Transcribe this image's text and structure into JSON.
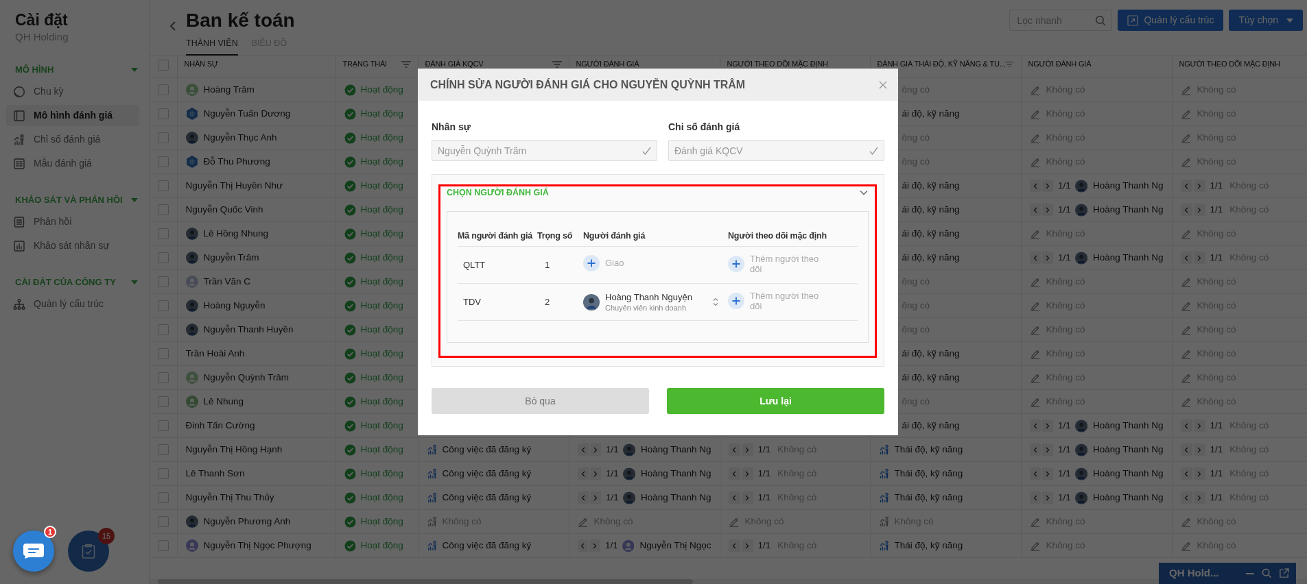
{
  "sidebar": {
    "title": "Cài đặt",
    "subtitle": "QH Holding",
    "sections": [
      {
        "heading": "MÔ HÌNH",
        "expanded": true,
        "items": [
          {
            "label": "Chu kỳ",
            "selected": false
          },
          {
            "label": "Mô hình đánh giá",
            "selected": true
          },
          {
            "label": "Chỉ số đánh giá",
            "selected": false
          },
          {
            "label": "Mẫu đánh giá",
            "selected": false
          }
        ]
      },
      {
        "heading": "KHẢO SÁT VÀ PHẢN HỒI",
        "expanded": true,
        "items": [
          {
            "label": "Phản hồi",
            "selected": false
          },
          {
            "label": "Khảo sát nhân sự",
            "selected": false
          }
        ]
      },
      {
        "heading": "CÀI ĐẶT CỦA CÔNG TY",
        "expanded": true,
        "items": [
          {
            "label": "Quản lý cấu trúc",
            "selected": false
          }
        ]
      }
    ]
  },
  "page": {
    "title": "Ban kế toán",
    "tabs": [
      {
        "label": "THÀNH VIÊN",
        "selected": true
      },
      {
        "label": "BIỂU ĐỒ",
        "selected": false
      }
    ]
  },
  "toolbar": {
    "search": {
      "placeholder": "Lọc nhanh"
    },
    "buttons": [
      {
        "label": "Quản lý cấu trúc",
        "kind": "link"
      },
      {
        "label": "Tùy chọn",
        "kind": "dropdown"
      }
    ]
  },
  "table": {
    "all_checked": false,
    "columns": [
      {
        "label": "NHÂN SỰ",
        "filter": false
      },
      {
        "label": "TRẠNG THÁI",
        "filter": true
      },
      {
        "label": "ĐÁNH GIÁ KQCV",
        "filter": true
      },
      {
        "label": "NGƯỜI ĐÁNH GIÁ",
        "filter": false
      },
      {
        "label": "NGƯỜI THEO DÕI MẶC ĐỊNH",
        "filter": false
      },
      {
        "label": "ĐÁNH GIÁ THÁI ĐỘ, KỸ NĂNG & TU...",
        "filter": true
      },
      {
        "label": "NGƯỜI ĐÁNH GIÁ",
        "filter": false
      },
      {
        "label": "NGƯỜI THEO DÕI MẶC ĐỊNH",
        "filter": false
      }
    ],
    "rows": [
      {
        "checked": false,
        "name": "Hoàng Trâm",
        "avatar": {
          "kind": "person",
          "color": "#394f39"
        },
        "status": "Hoạt động",
        "attitude": {
          "kind": "metric-cut",
          "text": "ông có",
          "empty": true
        },
        "attitude_reviewer": {
          "kind": "edit",
          "text": "Không có"
        },
        "attitude_follower": {
          "kind": "edit",
          "text": "Không có"
        }
      },
      {
        "checked": false,
        "name": "Nguyễn Tuấn Dương",
        "avatar": {
          "kind": "logo"
        },
        "status": "Hoạt động",
        "attitude": {
          "kind": "metric-cut",
          "text": "ái độ, kỹ năng",
          "empty": false
        },
        "attitude_reviewer": {
          "kind": "edit",
          "text": "Không có"
        },
        "attitude_follower": {
          "kind": "edit",
          "text": "Không có"
        }
      },
      {
        "checked": false,
        "name": "Nguyễn Thục Anh",
        "avatar": {
          "kind": "photo"
        },
        "status": "Hoạt động",
        "attitude": {
          "kind": "metric-cut",
          "text": "ông có",
          "empty": true
        },
        "attitude_reviewer": {
          "kind": "edit",
          "text": "Không có"
        },
        "attitude_follower": {
          "kind": "edit",
          "text": "Không có"
        }
      },
      {
        "checked": false,
        "name": "Đỗ Thu Phương",
        "avatar": {
          "kind": "logo"
        },
        "status": "Hoạt động",
        "attitude": {
          "kind": "metric-cut",
          "text": "ông có",
          "empty": true
        },
        "attitude_reviewer": {
          "kind": "edit",
          "text": "Không có"
        },
        "attitude_follower": {
          "kind": "edit",
          "text": "Không có"
        }
      },
      {
        "checked": false,
        "name": "Nguyễn Thị Huyền Như",
        "status": "Hoạt động",
        "attitude": {
          "kind": "metric-cut",
          "text": "ái độ, kỹ năng",
          "empty": false
        },
        "attitude_reviewer": {
          "kind": "pager",
          "page": "1/1",
          "person": "Hoàng Thanh Ng",
          "avatar": {
            "kind": "photo"
          }
        },
        "attitude_follower": {
          "kind": "pager",
          "page": "1/1",
          "text": "Không có"
        }
      },
      {
        "checked": false,
        "name": "Nguyễn Quốc Vinh",
        "status": "Hoạt động",
        "attitude": {
          "kind": "metric-cut",
          "text": "ái độ, kỹ năng",
          "empty": false
        },
        "attitude_reviewer": {
          "kind": "pager",
          "page": "1/1",
          "person": "Hoàng Thanh Ng",
          "avatar": {
            "kind": "photo"
          }
        },
        "attitude_follower": {
          "kind": "pager",
          "page": "1/1",
          "text": "Không có"
        }
      },
      {
        "checked": false,
        "name": "Lê Hồng Nhung",
        "avatar": {
          "kind": "photo"
        },
        "status": "Hoạt động",
        "attitude": {
          "kind": "metric-cut",
          "text": "ái độ, kỹ năng",
          "empty": false
        },
        "attitude_reviewer": {
          "kind": "edit",
          "text": "Không có"
        },
        "attitude_follower": {
          "kind": "edit",
          "text": "Không có"
        }
      },
      {
        "checked": false,
        "name": "Nguyễn Trâm",
        "avatar": {
          "kind": "photo"
        },
        "status": "Hoạt động",
        "attitude": {
          "kind": "metric-cut",
          "text": "ái độ, kỹ năng",
          "empty": false
        },
        "attitude_reviewer": {
          "kind": "pager",
          "page": "1/1",
          "person": "Hoàng Thanh Ng",
          "avatar": {
            "kind": "photo"
          }
        },
        "attitude_follower": {
          "kind": "pager",
          "page": "1/1",
          "text": "Không có"
        }
      },
      {
        "checked": false,
        "name": "Trần Văn C",
        "avatar": {
          "kind": "person",
          "color": "#484c57"
        },
        "status": "Hoạt động",
        "attitude": {
          "kind": "metric-cut",
          "text": "ông có",
          "empty": true
        },
        "attitude_reviewer": {
          "kind": "edit",
          "text": "Không có"
        },
        "attitude_follower": {
          "kind": "edit",
          "text": "Không có"
        }
      },
      {
        "checked": false,
        "name": "Hoàng Nguyễn",
        "avatar": {
          "kind": "photo"
        },
        "status": "Hoạt động",
        "attitude": {
          "kind": "metric-cut",
          "text": "ông có",
          "empty": true
        },
        "attitude_reviewer": {
          "kind": "edit",
          "text": "Không có"
        },
        "attitude_follower": {
          "kind": "edit",
          "text": "Không có"
        }
      },
      {
        "checked": false,
        "name": "Nguyễn Thanh Huyền",
        "avatar": {
          "kind": "photo"
        },
        "status": "Hoạt động",
        "attitude": {
          "kind": "metric-cut",
          "text": "ông có",
          "empty": true
        },
        "attitude_reviewer": {
          "kind": "edit",
          "text": "Không có"
        },
        "attitude_follower": {
          "kind": "edit",
          "text": "Không có"
        }
      },
      {
        "checked": false,
        "name": "Trần Hoài Anh",
        "status": "Hoạt động",
        "attitude": {
          "kind": "metric-cut",
          "text": "ái độ, kỹ năng",
          "empty": false
        },
        "attitude_reviewer": {
          "kind": "edit",
          "text": "Không có"
        },
        "attitude_follower": {
          "kind": "edit",
          "text": "Không có"
        }
      },
      {
        "checked": false,
        "name": "Nguyễn Quỳnh Trâm",
        "avatar": {
          "kind": "person",
          "color": "#3e503e"
        },
        "status": "Hoạt động",
        "attitude": {
          "kind": "metric-cut",
          "text": "ái độ, kỹ năng",
          "empty": false
        },
        "attitude_reviewer": {
          "kind": "edit",
          "text": "Không có"
        },
        "attitude_follower": {
          "kind": "edit",
          "text": "Không có"
        }
      },
      {
        "checked": false,
        "name": "Lê Nhung",
        "avatar": {
          "kind": "person",
          "color": "#334a32"
        },
        "status": "Hoạt động",
        "attitude": {
          "kind": "metric-cut",
          "text": "ông có",
          "empty": true
        },
        "attitude_reviewer": {
          "kind": "edit",
          "text": "Không có"
        },
        "attitude_follower": {
          "kind": "edit",
          "text": "Không có"
        }
      },
      {
        "checked": false,
        "name": "Đinh Tấn Cường",
        "status": "Hoạt động",
        "attitude": {
          "kind": "metric-cut",
          "text": "ái độ, kỹ năng",
          "empty": false
        },
        "attitude_reviewer": {
          "kind": "pager",
          "page": "1/1",
          "person": "Hoàng Thanh Ng",
          "avatar": {
            "kind": "photo"
          }
        },
        "attitude_follower": {
          "kind": "pager",
          "page": "1/1",
          "text": "Không có"
        }
      },
      {
        "checked": false,
        "name": "Nguyễn Thị Hồng Hạnh",
        "status": "Hoạt động",
        "kqcv": {
          "kind": "metric",
          "text": "Công việc đã đăng ký",
          "empty": false
        },
        "reviewer": {
          "kind": "pager",
          "page": "1/1",
          "person": "Hoàng Thanh Ng",
          "avatar": {
            "kind": "photo"
          }
        },
        "follower": {
          "kind": "pager",
          "page": "1/1",
          "text": "Không có"
        },
        "attitude": {
          "kind": "metric",
          "text": "Thái độ, kỹ năng",
          "empty": false
        },
        "attitude_reviewer": {
          "kind": "pager",
          "page": "1/1",
          "person": "Hoàng Thanh Ng",
          "avatar": {
            "kind": "photo"
          }
        },
        "attitude_follower": {
          "kind": "pager",
          "page": "1/1",
          "text": "Không có"
        }
      },
      {
        "checked": false,
        "name": "Lê Thanh Sơn",
        "status": "Hoạt động",
        "kqcv": {
          "kind": "metric",
          "text": "Công việc đã đăng ký",
          "empty": false
        },
        "reviewer": {
          "kind": "pager",
          "page": "1/1",
          "person": "Hoàng Thanh Ng",
          "avatar": {
            "kind": "photo"
          }
        },
        "follower": {
          "kind": "pager",
          "page": "1/1",
          "text": "Không có"
        },
        "attitude": {
          "kind": "metric",
          "text": "Thái độ, kỹ năng",
          "empty": false
        },
        "attitude_reviewer": {
          "kind": "pager",
          "page": "1/1",
          "person": "Hoàng Thanh Ng",
          "avatar": {
            "kind": "photo"
          }
        },
        "attitude_follower": {
          "kind": "pager",
          "page": "1/1",
          "text": "Không có"
        }
      },
      {
        "checked": false,
        "name": "Nguyễn Thị Thu Thủy",
        "status": "Hoạt động",
        "kqcv": {
          "kind": "metric",
          "text": "Công việc đã đăng ký",
          "empty": false
        },
        "reviewer": {
          "kind": "pager",
          "page": "1/1",
          "person": "Hoàng Thanh Ng",
          "avatar": {
            "kind": "photo"
          }
        },
        "follower": {
          "kind": "pager",
          "page": "1/1",
          "text": "Không có"
        },
        "attitude": {
          "kind": "metric",
          "text": "Thái độ, kỹ năng",
          "empty": false
        },
        "attitude_reviewer": {
          "kind": "pager",
          "page": "1/1",
          "person": "Hoàng Thanh Ng",
          "avatar": {
            "kind": "photo"
          }
        },
        "attitude_follower": {
          "kind": "pager",
          "page": "1/1",
          "text": "Không có"
        }
      },
      {
        "checked": false,
        "name": "Nguyễn Phương Anh",
        "avatar": {
          "kind": "photo"
        },
        "status": "Hoạt động",
        "kqcv": {
          "kind": "metric",
          "text": "Không có",
          "empty": true
        },
        "reviewer": {
          "kind": "edit",
          "text": "Không có"
        },
        "follower": {
          "kind": "edit",
          "text": "Không có"
        },
        "attitude": {
          "kind": "metric",
          "text": "Không có",
          "empty": true
        },
        "attitude_reviewer": {
          "kind": "edit",
          "text": "Không có"
        },
        "attitude_follower": {
          "kind": "edit",
          "text": "Không có"
        }
      },
      {
        "checked": false,
        "name": "Nguyễn Thị Ngọc Phượng",
        "avatar": {
          "kind": "person",
          "color": "#373756"
        },
        "status": "Hoạt động",
        "kqcv": {
          "kind": "metric",
          "text": "Công việc đã đăng ký",
          "empty": false
        },
        "reviewer": {
          "kind": "pager",
          "page": "1/1",
          "person": "Nguyễn Thị Ngọc",
          "avatar": {
            "kind": "person",
            "color": "#373756"
          }
        },
        "follower": {
          "kind": "pager",
          "page": "1/1",
          "text": "Không có"
        },
        "attitude": {
          "kind": "metric",
          "text": "Thái độ, kỹ năng",
          "empty": false
        },
        "attitude_reviewer": {
          "kind": "edit",
          "text": "Không có"
        },
        "attitude_follower": {
          "kind": "edit",
          "text": "Không có"
        }
      }
    ]
  },
  "modal": {
    "title": "CHÍNH SỬA NGƯỜI ĐÁNH GIÁ CHO NGUYỄN QUỲNH TRÂM",
    "fields": [
      {
        "label": "Nhân sự",
        "value": "Nguyễn Quỳnh Trâm",
        "disabled": true
      },
      {
        "label": "Chỉ số đánh giá",
        "value": "Đánh giá KQCV",
        "disabled": true
      }
    ],
    "section": {
      "title": "CHỌN NGƯỜI ĐÁNH GIÁ",
      "expanded": true,
      "columns": [
        "Mã người đánh giá",
        "Trọng số",
        "Người đánh giá",
        "Người theo dõi mặc định"
      ],
      "rows": [
        {
          "code": "QLTT",
          "weight": "1",
          "reviewer": {
            "kind": "add",
            "text": "Giao"
          },
          "follower": {
            "kind": "add",
            "text": "Thêm người theo dõi"
          }
        },
        {
          "code": "TDV",
          "weight": "2",
          "reviewer": {
            "kind": "person",
            "name": "Hoàng Thanh Nguyện",
            "role": "Chuyên viên kinh doanh"
          },
          "follower": {
            "kind": "add",
            "text": "Thêm người theo dõi"
          }
        }
      ]
    },
    "buttons": [
      {
        "label": "Bỏ qua",
        "kind": "secondary"
      },
      {
        "label": "Lưu lại",
        "kind": "primary"
      }
    ]
  },
  "chat_button": {
    "badge": "1"
  },
  "task_button": {
    "badge": "15"
  },
  "mini_panel": {
    "title": "QH Hold..."
  }
}
